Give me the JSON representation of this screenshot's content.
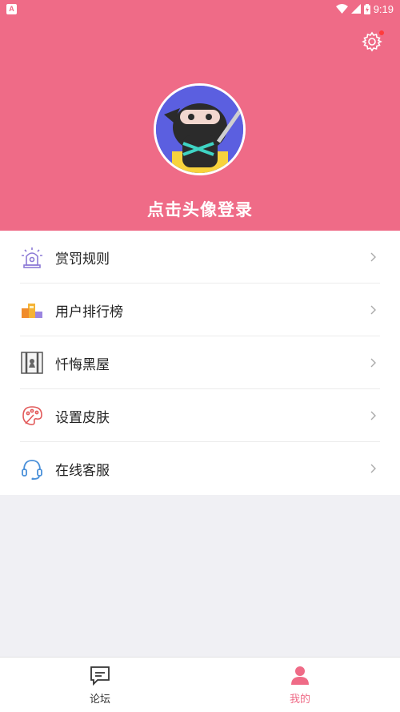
{
  "status_bar": {
    "time": "9:19",
    "notif_letter": "A"
  },
  "header": {
    "login_prompt": "点击头像登录"
  },
  "menu": {
    "items": [
      {
        "label": "赏罚规则",
        "icon": "siren-icon"
      },
      {
        "label": "用户排行榜",
        "icon": "leaderboard-icon"
      },
      {
        "label": "忏悔黑屋",
        "icon": "jail-icon"
      },
      {
        "label": "设置皮肤",
        "icon": "palette-icon"
      },
      {
        "label": "在线客服",
        "icon": "headset-icon"
      }
    ]
  },
  "bottom_nav": {
    "forum": "论坛",
    "mine": "我的"
  },
  "colors": {
    "brand": "#ef6b87",
    "background": "#f0f0f4"
  }
}
